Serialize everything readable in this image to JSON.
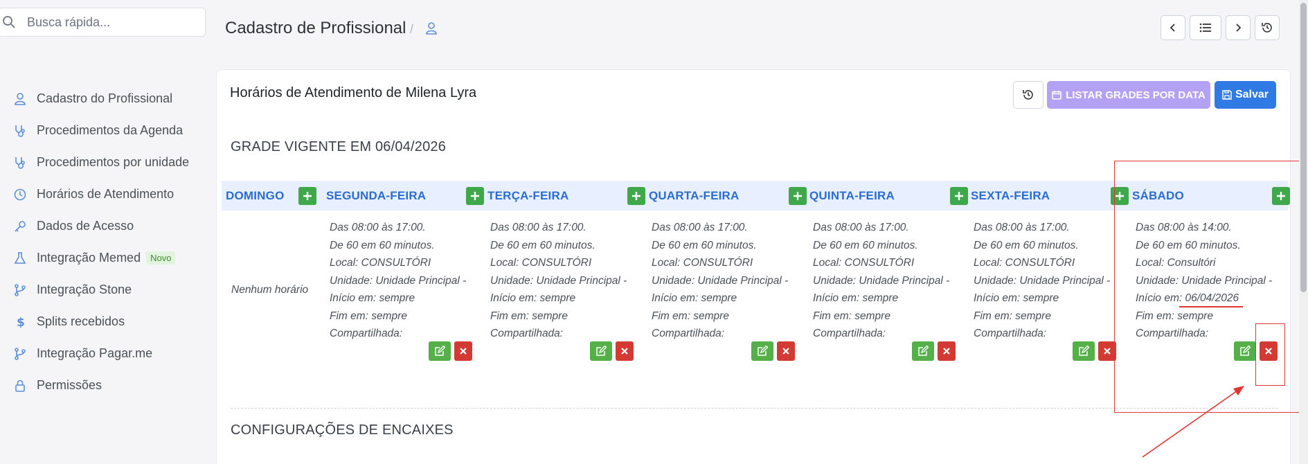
{
  "search": {
    "placeholder": "Busca rápida..."
  },
  "sidebar": {
    "items": [
      {
        "label": "Cadastro do Profissional",
        "icon": "user-doctor-icon"
      },
      {
        "label": "Procedimentos da Agenda",
        "icon": "stethoscope-icon"
      },
      {
        "label": "Procedimentos por unidade",
        "icon": "stethoscope-icon"
      },
      {
        "label": "Horários de Atendimento",
        "icon": "clock-icon"
      },
      {
        "label": "Dados de Acesso",
        "icon": "key-icon"
      },
      {
        "label": "Integração Memed",
        "icon": "flask-icon",
        "badge": "Novo"
      },
      {
        "label": "Integração Stone",
        "icon": "branch-icon"
      },
      {
        "label": "Splits recebidos",
        "icon": "dollar-icon"
      },
      {
        "label": "Integração Pagar.me",
        "icon": "branch-icon"
      },
      {
        "label": "Permissões",
        "icon": "lock-icon"
      }
    ]
  },
  "header": {
    "title": "Cadastro de Profissional",
    "separator": "/"
  },
  "card": {
    "title": "Horários de Atendimento de Milena Lyra",
    "list_button": "LISTAR GRADES POR DATA",
    "save_button": "Salvar"
  },
  "grade": {
    "title": "GRADE VIGENTE EM 06/04/2026",
    "days": [
      {
        "name": "DOMINGO"
      },
      {
        "name": "SEGUNDA-FEIRA"
      },
      {
        "name": "TERÇA-FEIRA"
      },
      {
        "name": "QUARTA-FEIRA"
      },
      {
        "name": "QUINTA-FEIRA"
      },
      {
        "name": "SEXTA-FEIRA"
      },
      {
        "name": "SÁBADO"
      }
    ],
    "empty_text": "Nenhum horário",
    "schedules": [
      {
        "hours": "Das 08:00 às 17:00.",
        "interval": "De 60 em 60 minutos.",
        "local": "Local: CONSULTÓRI",
        "unidade": "Unidade: Unidade Principal -",
        "inicio": "Início em: sempre",
        "fim": "Fim em: sempre",
        "compartilhada": "Compartilhada:"
      },
      {
        "hours": "Das 08:00 às 17:00.",
        "interval": "De 60 em 60 minutos.",
        "local": "Local: CONSULTÓRI",
        "unidade": "Unidade: Unidade Principal -",
        "inicio": "Início em: sempre",
        "fim": "Fim em: sempre",
        "compartilhada": "Compartilhada:"
      },
      {
        "hours": "Das 08:00 às 17:00.",
        "interval": "De 60 em 60 minutos.",
        "local": "Local: CONSULTÓRI",
        "unidade": "Unidade: Unidade Principal -",
        "inicio": "Início em: sempre",
        "fim": "Fim em: sempre",
        "compartilhada": "Compartilhada:"
      },
      {
        "hours": "Das 08:00 às 17:00.",
        "interval": "De 60 em 60 minutos.",
        "local": "Local: CONSULTÓRI",
        "unidade": "Unidade: Unidade Principal -",
        "inicio": "Início em: sempre",
        "fim": "Fim em: sempre",
        "compartilhada": "Compartilhada:"
      },
      {
        "hours": "Das 08:00 às 17:00.",
        "interval": "De 60 em 60 minutos.",
        "local": "Local: CONSULTÓRI",
        "unidade": "Unidade: Unidade Principal -",
        "inicio": "Início em: sempre",
        "fim": "Fim em: sempre",
        "compartilhada": "Compartilhada:"
      },
      {
        "hours": "Das 08:00 às 14:00.",
        "interval": "De 60 em 60 minutos.",
        "local": "Local: Consultóri",
        "unidade": "Unidade: Unidade Principal -",
        "inicio": "Início em: 06/04/2026",
        "fim": "Fim em: sempre",
        "compartilhada": "Compartilhada:"
      }
    ]
  },
  "encaixes": {
    "title": "CONFIGURAÇÕES DE ENCAIXES"
  },
  "colors": {
    "primary": "#2f7ae5",
    "purple": "#b3a2f3",
    "green": "#3fa84a",
    "red": "#d33a33",
    "day_header_bg": "#e8efff",
    "day_header_text": "#2a6ccf",
    "annotation": "#e03535"
  }
}
